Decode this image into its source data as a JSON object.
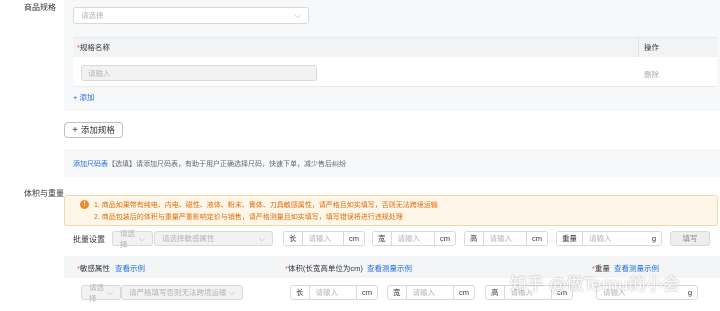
{
  "spec": {
    "section_label": "商品规格",
    "select_placeholder": "请选择",
    "table": {
      "col_name": "规格名称",
      "col_action": "操作",
      "row_input_placeholder": "请输入",
      "row_delete": "删除"
    },
    "add_link": "+ 添加",
    "add_spec_button": "添加规格",
    "size_chart_link": "添加尺码表",
    "size_chart_hint": "【选填】请添加尺码表，有助于用户正确选择尺码，快速下单，减少售后纠纷"
  },
  "volume": {
    "section_label": "体积与重量",
    "warnings": [
      "1.  商品如果带有纯电、内电、磁性、液体、粉末、膏体、刀具敏感属性，请严格且如实填写，否则无法跨境运输",
      "2.  商品包装后的体积与重量严重影响定价与销售，请严格测量且如实填写，填写错误将进行违规处理"
    ],
    "batch": {
      "label": "批量设置",
      "select1": "请选择",
      "select2": "请选择敏感属性",
      "len_prefix": "长",
      "wid_prefix": "宽",
      "hei_prefix": "高",
      "weight_prefix": "重量",
      "input_placeholder": "请输入",
      "unit_cm": "cm",
      "unit_g": "g",
      "fill_button": "填写"
    },
    "headers": {
      "sensitive": "敏感属性",
      "sensitive_link": "查看示例",
      "dims": "体积(长宽高单位为cm)",
      "dims_link": "查看测量示例",
      "weight": "重量",
      "weight_link": "查看测量示例"
    },
    "row": {
      "select1": "请选择",
      "select2": "请严格填写否则无法跨境运输"
    }
  },
  "watermark": "知乎 @做Temu的小会",
  "colors": {
    "link": "#1f6fe0",
    "required": "#e34d3b",
    "warning_text": "#e36a00",
    "warning_bg": "#fff6ea",
    "panel_bg": "#f7f8fa"
  }
}
